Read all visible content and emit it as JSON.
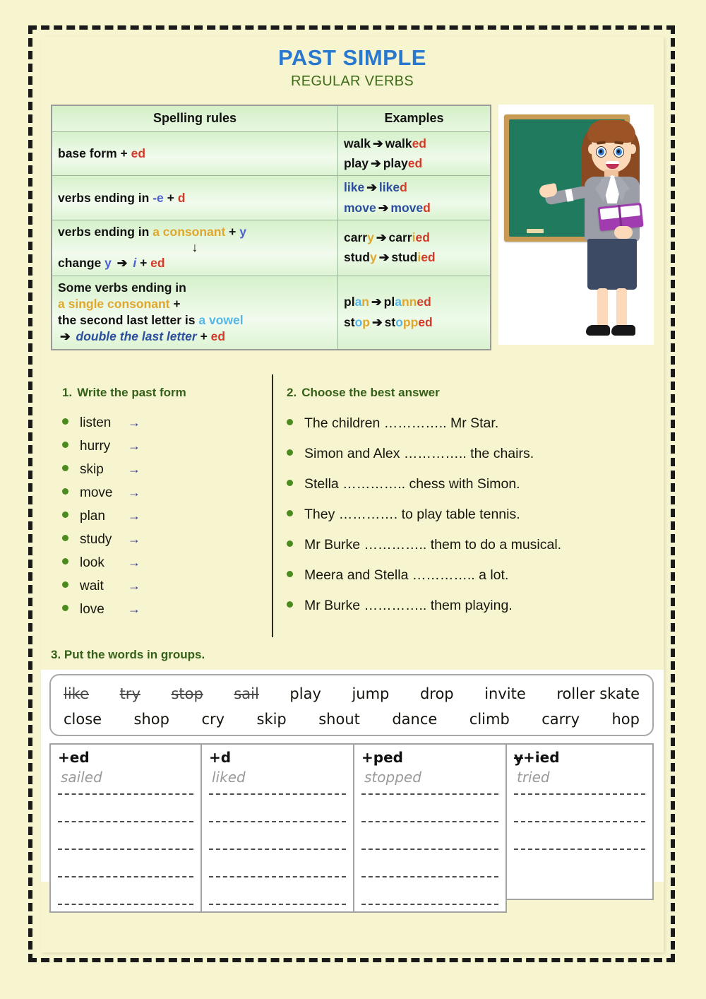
{
  "header": {
    "title": "PAST SIMPLE",
    "subtitle": "REGULAR VERBS",
    "title_color": "#2878d0",
    "subtitle_color": "#3f6a18"
  },
  "rules_table": {
    "columns": [
      "Spelling rules",
      "Examples"
    ],
    "rows": [
      {
        "rule": "base form  +  ed",
        "examples": [
          "walk ➔ walked",
          "play ➔ played"
        ]
      },
      {
        "rule": "verbs ending in -e  +  d",
        "examples": [
          "like ➔ liked",
          "move ➔ moved"
        ]
      },
      {
        "rule": "verbs ending in a consonant + y  ↓  change y ➔ i + ed",
        "examples": [
          "carry ➔ carried",
          "study ➔ studied"
        ]
      },
      {
        "rule": "Some verbs ending in a single consonant + the second last letter is a vowel ➔ double the last letter + ed",
        "examples": [
          "plan ➔ planned",
          "stop ➔ stopped"
        ]
      }
    ],
    "rule_fragments": {
      "r1_base": "base form",
      "r1_plus": "+",
      "r1_ed": "ed",
      "r2_lead": "verbs ending in",
      "r2_e": "-e",
      "r2_plus": "+",
      "r2_d": "d",
      "r3_lead": "verbs ending in",
      "r3_consonant": "a consonant",
      "r3_plus": "+",
      "r3_y": "y",
      "r3_down": "↓",
      "r3_change": "change",
      "r3_y2": "y",
      "r3_arrow": "➔",
      "r3_i": "i",
      "r3_plus2": "+",
      "r3_ed": "ed",
      "r4_line1": "Some verbs ending in",
      "r4_single": "a single consonant",
      "r4_plus": "+",
      "r4_line3a": "the second last letter is",
      "r4_vowel": "a vowel",
      "r4_arrow": "➔",
      "r4_double": "double the last letter",
      "r4_plus2": "+",
      "r4_ed": "ed"
    },
    "example_fragments": {
      "walk": {
        "base": "walk",
        "stem": "walk",
        "suffix": "ed"
      },
      "play": {
        "base": "play",
        "stem": "play",
        "suffix": "ed"
      },
      "like": {
        "base": "like",
        "stem": "like",
        "suffix": "d"
      },
      "move": {
        "base": "move",
        "stem": "move",
        "suffix": "d"
      },
      "carry": {
        "base_a": "carr",
        "base_b": "y",
        "stem": "carr",
        "mid": "i",
        "suffix": "ed"
      },
      "study": {
        "base_a": "stud",
        "base_b": "y",
        "stem": "stud",
        "mid": "i",
        "suffix": "ed"
      },
      "plan": {
        "base_a": "pl",
        "base_b": "a",
        "base_c": "n",
        "stem_a": "pl",
        "stem_b": "a",
        "dbl": "nn",
        "suffix": "ed"
      },
      "stop": {
        "base_a": "st",
        "base_b": "o",
        "base_c": "p",
        "stem_a": "st",
        "stem_b": "o",
        "dbl": "pp",
        "suffix": "ed"
      }
    },
    "arrow": "➔",
    "colors": {
      "red": "#d33b29",
      "blue": "#4a5fd0",
      "orange": "#e0a72e",
      "light_blue": "#55b6e8",
      "navy": "#2b4f9e",
      "header_bg": "#d4efc8",
      "cell_bg": "#d9f2cf"
    }
  },
  "illustration": {
    "name": "teacher-at-chalkboard",
    "board_color": "#1f7a5e",
    "frame_color": "#c89a54",
    "hair_color": "#8b4a22",
    "jacket_color": "#9b9ea6",
    "skirt_color": "#3c4a63",
    "book_color": "#a03cb0"
  },
  "exercise1": {
    "number": "1.",
    "heading": "Write the past form",
    "arrow": "→",
    "items": [
      "listen",
      "hurry",
      "skip",
      "move",
      "plan",
      "study",
      "look",
      "wait",
      "love"
    ]
  },
  "exercise2": {
    "number": "2.",
    "heading": "Choose the best answer",
    "items": [
      "The children ………….. Mr Star.",
      "Simon and Alex ………….. the chairs.",
      "Stella ………….. chess with Simon.",
      "They …………. to play table tennis.",
      "Mr Burke ………….. them to do a musical.",
      "Meera and Stella ………….. a lot.",
      "Mr Burke ………….. them playing."
    ]
  },
  "exercise3": {
    "number": "3.",
    "heading": "Put the words in groups.",
    "wordbank_row1": [
      {
        "word": "like",
        "struck": true
      },
      {
        "word": "try",
        "struck": true
      },
      {
        "word": "stop",
        "struck": true
      },
      {
        "word": "sail",
        "struck": true
      },
      {
        "word": "play",
        "struck": false
      },
      {
        "word": "jump",
        "struck": false
      },
      {
        "word": "drop",
        "struck": false
      },
      {
        "word": "invite",
        "struck": false
      },
      {
        "word": "roller skate",
        "struck": false
      }
    ],
    "wordbank_row2": [
      {
        "word": "close",
        "struck": false
      },
      {
        "word": "shop",
        "struck": false
      },
      {
        "word": "cry",
        "struck": false
      },
      {
        "word": "skip",
        "struck": false
      },
      {
        "word": "shout",
        "struck": false
      },
      {
        "word": "dance",
        "struck": false
      },
      {
        "word": "climb",
        "struck": false
      },
      {
        "word": "carry",
        "struck": false
      },
      {
        "word": "hop",
        "struck": false
      }
    ],
    "groups": [
      {
        "header": "+ed",
        "header_strike": "",
        "header_rest": "+ed",
        "answer": "sailed",
        "blank_lines": 5
      },
      {
        "header": "+d",
        "header_strike": "",
        "header_rest": "+d",
        "answer": "liked",
        "blank_lines": 5
      },
      {
        "header": "+ped",
        "header_strike": "",
        "header_rest": "+ped",
        "answer": "stopped",
        "blank_lines": 5
      },
      {
        "header": "y+ied",
        "header_strike": "y",
        "header_rest": "+ied",
        "answer": "tried",
        "blank_lines": 3
      }
    ]
  }
}
